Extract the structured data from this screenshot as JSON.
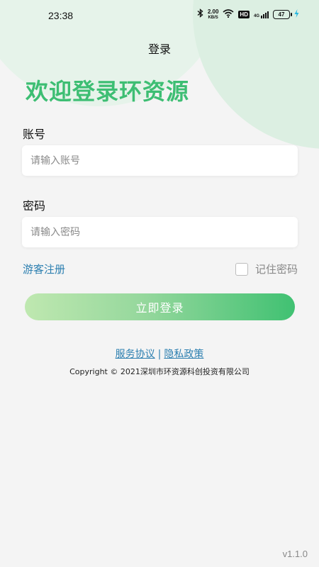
{
  "status_bar": {
    "time": "23:38",
    "net_speed_value": "2.00",
    "net_speed_unit": "KB/S",
    "hd_label": "HD",
    "signal_label": "4G",
    "battery_level": "47",
    "icons": [
      "bluetooth-icon",
      "wifi-icon",
      "signal-icon",
      "battery-icon",
      "charging-icon"
    ]
  },
  "header": {
    "title": "登录"
  },
  "welcome_text": "欢迎登录环资源",
  "form": {
    "account_label": "账号",
    "account_placeholder": "请输入账号",
    "account_value": "",
    "password_label": "密码",
    "password_placeholder": "请输入密码",
    "password_value": "",
    "guest_register": "游客注册",
    "remember_label": "记住密码",
    "remember_checked": false,
    "login_button": "立即登录"
  },
  "footer": {
    "service_agreement": "服务协议",
    "separator": "|",
    "privacy_policy": "隐私政策",
    "copyright": "Copyright © 2021深圳市环资源科创投资有限公司",
    "version": "v1.1.0"
  },
  "colors": {
    "accent_green": "#3dbe73",
    "link_blue": "#2c7fb0",
    "background": "#f4f4f4"
  }
}
